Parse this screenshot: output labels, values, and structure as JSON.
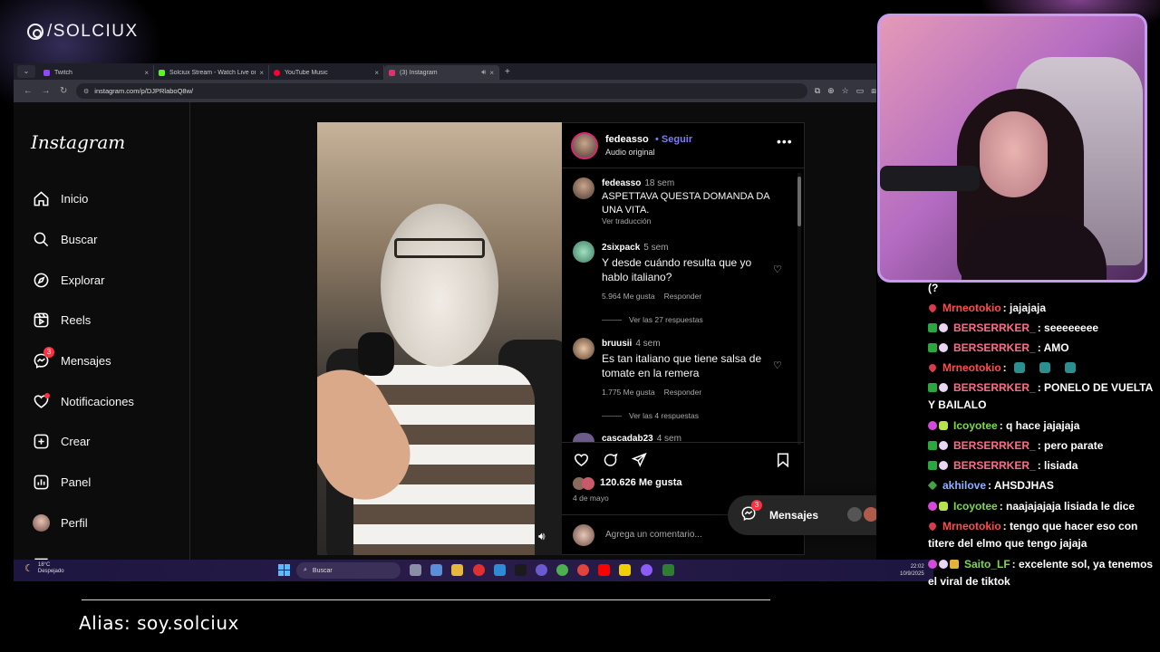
{
  "overlay": {
    "brand": "/SOLCIUX",
    "alias": "Alias: soy.solciux"
  },
  "browser": {
    "tabs": [
      {
        "title": "Twitch",
        "favicon": "twitch-icon",
        "color": "#9146ff"
      },
      {
        "title": "Solciux Stream - Watch Live on",
        "favicon": "kick-icon",
        "color": "#53fc18"
      },
      {
        "title": "YouTube Music",
        "favicon": "youtube-music-icon",
        "color": "#ff0033"
      },
      {
        "title": "(3) Instagram",
        "favicon": "instagram-icon",
        "color": "#e1306c",
        "active": true
      }
    ],
    "url": "instagram.com/p/DJPRlaboQ8w/"
  },
  "instagram": {
    "logo": "Instagram",
    "nav": [
      {
        "label": "Inicio",
        "icon": "home-icon"
      },
      {
        "label": "Buscar",
        "icon": "search-icon"
      },
      {
        "label": "Explorar",
        "icon": "compass-icon"
      },
      {
        "label": "Reels",
        "icon": "reels-icon"
      },
      {
        "label": "Mensajes",
        "icon": "messenger-icon",
        "badge": "3"
      },
      {
        "label": "Notificaciones",
        "icon": "heart-icon"
      },
      {
        "label": "Crear",
        "icon": "plus-square-icon"
      },
      {
        "label": "Panel",
        "icon": "chart-icon"
      },
      {
        "label": "Perfil",
        "icon": "avatar-icon"
      }
    ],
    "post": {
      "author": "fedeasso",
      "follow": "• Seguir",
      "audio": "Audio original",
      "caption": {
        "user": "fedeasso",
        "time": "18 sem",
        "text": "ASPETTAVA QUESTA DOMANDA DA UNA VITA.",
        "translate": "Ver traducción"
      },
      "comments": [
        {
          "user": "2sixpack",
          "time": "5 sem",
          "text": "Y desde cuándo resulta que yo hablo italiano?",
          "likes": "5.964 Me gusta",
          "reply": "Responder",
          "replies": "Ver las 27 respuestas"
        },
        {
          "user": "bruusii",
          "time": "4 sem",
          "text": "Es tan italiano que tiene salsa de tomate en la remera",
          "likes": "1.775 Me gusta",
          "reply": "Responder",
          "replies": "Ver las 4 respuestas"
        },
        {
          "user": "cascadab23",
          "time": "4 sem"
        }
      ],
      "likes": "120.626 Me gusta",
      "date": "4 de mayo",
      "comment_placeholder": "Agrega un comentario..."
    },
    "messages_bubble": {
      "label": "Mensajes",
      "badge": "3"
    }
  },
  "taskbar": {
    "weather_temp": "18°C",
    "weather_desc": "Despejado",
    "search": "Buscar",
    "time": "22:02",
    "date": "10/9/2025"
  },
  "chat": {
    "top_fragment": "(?",
    "messages": [
      {
        "badges": [
          "heart"
        ],
        "user": "Mrneotokio",
        "color": "#ff4d4d",
        "text": ": jajajaja"
      },
      {
        "badges": [
          "check",
          "bunny"
        ],
        "user": "BERSERRKER_",
        "color": "#ff6b8b",
        "text": ": seeeeeeee"
      },
      {
        "badges": [
          "check",
          "bunny"
        ],
        "user": "BERSERRKER_",
        "color": "#ff6b8b",
        "text": ": AMO"
      },
      {
        "badges": [
          "heart"
        ],
        "user": "Mrneotokio",
        "color": "#ff4d4d",
        "text": ":",
        "emotes": 3
      },
      {
        "badges": [
          "check",
          "bunny"
        ],
        "user": "BERSERRKER_",
        "color": "#ff6b8b",
        "text": ": PONELO DE VUELTA Y BAILALO"
      },
      {
        "badges": [
          "gem",
          "cat"
        ],
        "user": "Icoyotee",
        "color": "#7fd84a",
        "text": ": q hace jajajaja"
      },
      {
        "badges": [
          "check",
          "bunny"
        ],
        "user": "BERSERRKER_",
        "color": "#ff6b8b",
        "text": ": pero parate"
      },
      {
        "badges": [
          "check",
          "bunny"
        ],
        "user": "BERSERRKER_",
        "color": "#ff6b8b",
        "text": ": lisiada"
      },
      {
        "badges": [
          "plus"
        ],
        "user": "akhilove",
        "color": "#8fb0ff",
        "text": ": AHSDJHAS"
      },
      {
        "badges": [
          "gem",
          "cat"
        ],
        "user": "Icoyotee",
        "color": "#7fd84a",
        "text": ": naajajajaja lisiada le dice"
      },
      {
        "badges": [
          "heart"
        ],
        "user": "Mrneotokio",
        "color": "#ff4d4d",
        "text": ": tengo que hacer eso con titere del elmo que tengo jajaja"
      },
      {
        "badges": [
          "gem",
          "bunny",
          "crown"
        ],
        "user": "Saito_LF",
        "color": "#7fd84a",
        "text": ": excelente sol, ya tenemos el viral de tiktok"
      }
    ]
  }
}
